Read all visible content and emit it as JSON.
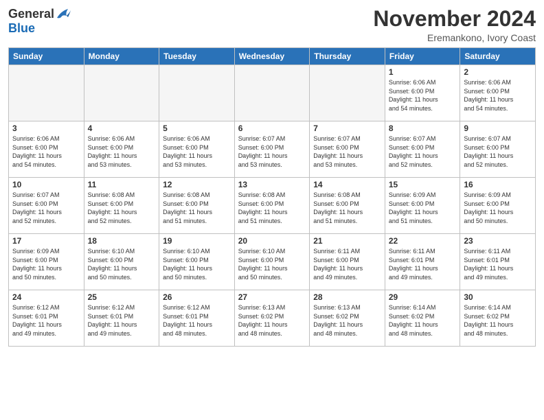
{
  "logo": {
    "general": "General",
    "blue": "Blue"
  },
  "title": "November 2024",
  "location": "Eremankono, Ivory Coast",
  "headers": [
    "Sunday",
    "Monday",
    "Tuesday",
    "Wednesday",
    "Thursday",
    "Friday",
    "Saturday"
  ],
  "weeks": [
    [
      {
        "day": "",
        "info": ""
      },
      {
        "day": "",
        "info": ""
      },
      {
        "day": "",
        "info": ""
      },
      {
        "day": "",
        "info": ""
      },
      {
        "day": "",
        "info": ""
      },
      {
        "day": "1",
        "info": "Sunrise: 6:06 AM\nSunset: 6:00 PM\nDaylight: 11 hours\nand 54 minutes."
      },
      {
        "day": "2",
        "info": "Sunrise: 6:06 AM\nSunset: 6:00 PM\nDaylight: 11 hours\nand 54 minutes."
      }
    ],
    [
      {
        "day": "3",
        "info": "Sunrise: 6:06 AM\nSunset: 6:00 PM\nDaylight: 11 hours\nand 54 minutes."
      },
      {
        "day": "4",
        "info": "Sunrise: 6:06 AM\nSunset: 6:00 PM\nDaylight: 11 hours\nand 53 minutes."
      },
      {
        "day": "5",
        "info": "Sunrise: 6:06 AM\nSunset: 6:00 PM\nDaylight: 11 hours\nand 53 minutes."
      },
      {
        "day": "6",
        "info": "Sunrise: 6:07 AM\nSunset: 6:00 PM\nDaylight: 11 hours\nand 53 minutes."
      },
      {
        "day": "7",
        "info": "Sunrise: 6:07 AM\nSunset: 6:00 PM\nDaylight: 11 hours\nand 53 minutes."
      },
      {
        "day": "8",
        "info": "Sunrise: 6:07 AM\nSunset: 6:00 PM\nDaylight: 11 hours\nand 52 minutes."
      },
      {
        "day": "9",
        "info": "Sunrise: 6:07 AM\nSunset: 6:00 PM\nDaylight: 11 hours\nand 52 minutes."
      }
    ],
    [
      {
        "day": "10",
        "info": "Sunrise: 6:07 AM\nSunset: 6:00 PM\nDaylight: 11 hours\nand 52 minutes."
      },
      {
        "day": "11",
        "info": "Sunrise: 6:08 AM\nSunset: 6:00 PM\nDaylight: 11 hours\nand 52 minutes."
      },
      {
        "day": "12",
        "info": "Sunrise: 6:08 AM\nSunset: 6:00 PM\nDaylight: 11 hours\nand 51 minutes."
      },
      {
        "day": "13",
        "info": "Sunrise: 6:08 AM\nSunset: 6:00 PM\nDaylight: 11 hours\nand 51 minutes."
      },
      {
        "day": "14",
        "info": "Sunrise: 6:08 AM\nSunset: 6:00 PM\nDaylight: 11 hours\nand 51 minutes."
      },
      {
        "day": "15",
        "info": "Sunrise: 6:09 AM\nSunset: 6:00 PM\nDaylight: 11 hours\nand 51 minutes."
      },
      {
        "day": "16",
        "info": "Sunrise: 6:09 AM\nSunset: 6:00 PM\nDaylight: 11 hours\nand 50 minutes."
      }
    ],
    [
      {
        "day": "17",
        "info": "Sunrise: 6:09 AM\nSunset: 6:00 PM\nDaylight: 11 hours\nand 50 minutes."
      },
      {
        "day": "18",
        "info": "Sunrise: 6:10 AM\nSunset: 6:00 PM\nDaylight: 11 hours\nand 50 minutes."
      },
      {
        "day": "19",
        "info": "Sunrise: 6:10 AM\nSunset: 6:00 PM\nDaylight: 11 hours\nand 50 minutes."
      },
      {
        "day": "20",
        "info": "Sunrise: 6:10 AM\nSunset: 6:00 PM\nDaylight: 11 hours\nand 50 minutes."
      },
      {
        "day": "21",
        "info": "Sunrise: 6:11 AM\nSunset: 6:00 PM\nDaylight: 11 hours\nand 49 minutes."
      },
      {
        "day": "22",
        "info": "Sunrise: 6:11 AM\nSunset: 6:01 PM\nDaylight: 11 hours\nand 49 minutes."
      },
      {
        "day": "23",
        "info": "Sunrise: 6:11 AM\nSunset: 6:01 PM\nDaylight: 11 hours\nand 49 minutes."
      }
    ],
    [
      {
        "day": "24",
        "info": "Sunrise: 6:12 AM\nSunset: 6:01 PM\nDaylight: 11 hours\nand 49 minutes."
      },
      {
        "day": "25",
        "info": "Sunrise: 6:12 AM\nSunset: 6:01 PM\nDaylight: 11 hours\nand 49 minutes."
      },
      {
        "day": "26",
        "info": "Sunrise: 6:12 AM\nSunset: 6:01 PM\nDaylight: 11 hours\nand 48 minutes."
      },
      {
        "day": "27",
        "info": "Sunrise: 6:13 AM\nSunset: 6:02 PM\nDaylight: 11 hours\nand 48 minutes."
      },
      {
        "day": "28",
        "info": "Sunrise: 6:13 AM\nSunset: 6:02 PM\nDaylight: 11 hours\nand 48 minutes."
      },
      {
        "day": "29",
        "info": "Sunrise: 6:14 AM\nSunset: 6:02 PM\nDaylight: 11 hours\nand 48 minutes."
      },
      {
        "day": "30",
        "info": "Sunrise: 6:14 AM\nSunset: 6:02 PM\nDaylight: 11 hours\nand 48 minutes."
      }
    ]
  ]
}
